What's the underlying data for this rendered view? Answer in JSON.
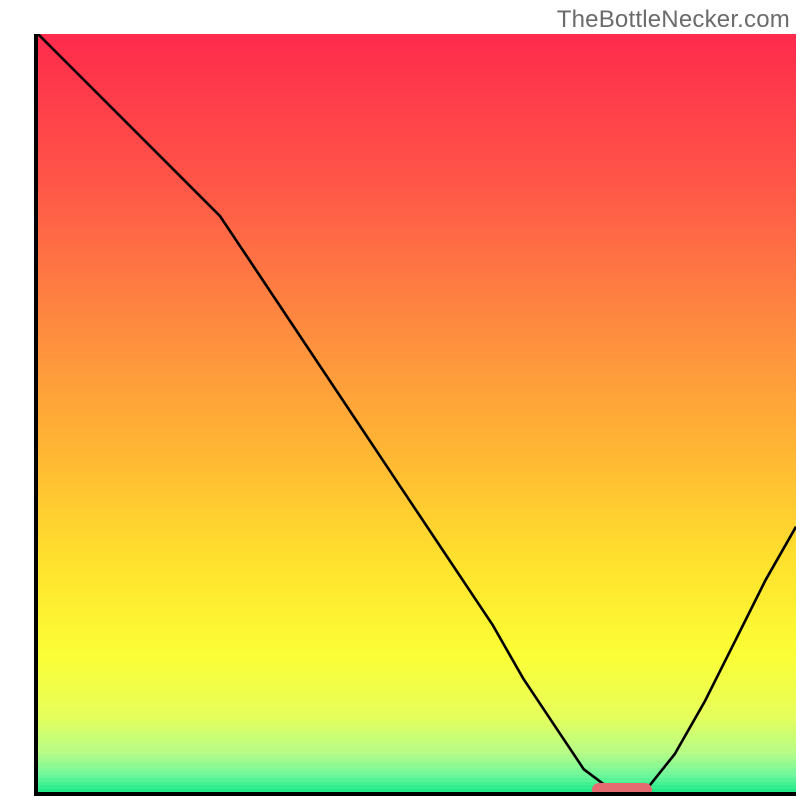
{
  "watermark_text": "TheBottleNecker.com",
  "colors": {
    "axis": "#000000",
    "marker": "#e46c70",
    "curve": "#000000"
  },
  "gradient_stops": [
    {
      "pct": 0,
      "color": "#fe2b4c"
    },
    {
      "pct": 20,
      "color": "#ff5748"
    },
    {
      "pct": 40,
      "color": "#fe8f3f"
    },
    {
      "pct": 55,
      "color": "#ffb634"
    },
    {
      "pct": 70,
      "color": "#ffe22d"
    },
    {
      "pct": 82,
      "color": "#fbfe35"
    },
    {
      "pct": 90,
      "color": "#e7fe5a"
    },
    {
      "pct": 95,
      "color": "#b6fc87"
    },
    {
      "pct": 98,
      "color": "#6ff79c"
    },
    {
      "pct": 100,
      "color": "#22ea8a"
    }
  ],
  "chart_data": {
    "type": "line",
    "title": "",
    "xlabel": "",
    "ylabel": "",
    "xlim": [
      0,
      100
    ],
    "ylim": [
      0,
      100
    ],
    "x": [
      0,
      6,
      12,
      18,
      24,
      30,
      36,
      42,
      48,
      54,
      60,
      64,
      68,
      72,
      76,
      80,
      84,
      88,
      92,
      96,
      100
    ],
    "bottleneck": [
      100,
      94,
      88,
      82,
      76,
      67,
      58,
      49,
      40,
      31,
      22,
      15,
      9,
      3,
      0,
      0,
      5,
      12,
      20,
      28,
      35
    ],
    "marker_x": 77,
    "marker_y": 0,
    "axis_ticks": {
      "x": [],
      "y": []
    }
  }
}
